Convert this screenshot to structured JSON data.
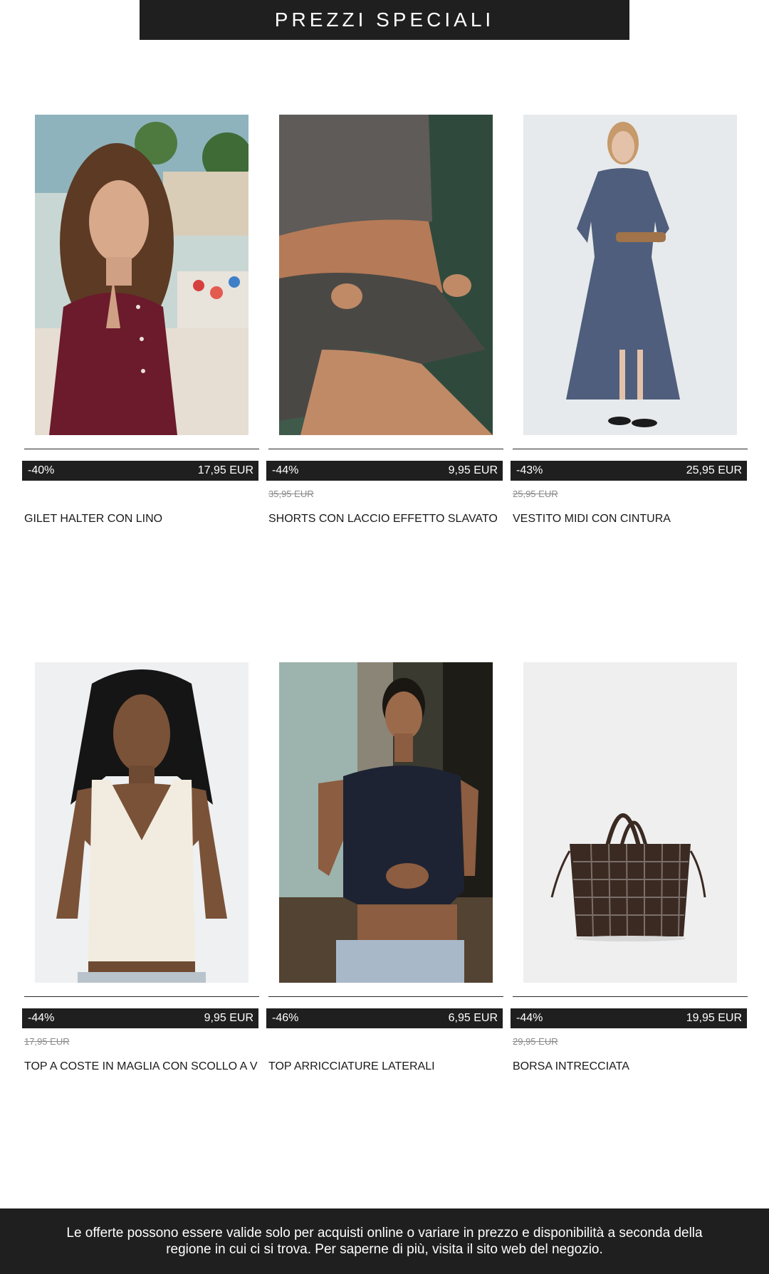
{
  "banner": {
    "title": "PREZZI SPECIALI"
  },
  "products": [
    {
      "discount": "-40%",
      "price": "17,95 EUR",
      "old_price": "",
      "name": "GILET HALTER CON LINO",
      "image": "woman-burgundy-halter-vest-by-sea"
    },
    {
      "discount": "-44%",
      "price": "9,95 EUR",
      "old_price": "35,95 EUR",
      "name": "SHORTS CON LACCIO EFFETTO SLAVATO",
      "image": "grey-washed-drawstring-shorts"
    },
    {
      "discount": "-43%",
      "price": "25,95 EUR",
      "old_price": "25,95 EUR",
      "name": "VESTITO MIDI CON CINTURA",
      "image": "blue-chambray-belted-midi-dress"
    },
    {
      "discount": "-44%",
      "price": "9,95 EUR",
      "old_price": "17,95 EUR",
      "name": "TOP A COSTE IN MAGLIA CON SCOLLO A V",
      "image": "cream-ribbed-knit-v-neck-top"
    },
    {
      "discount": "-46%",
      "price": "6,95 EUR",
      "old_price": "",
      "name": "TOP ARRICCIATURE LATERALI",
      "image": "navy-side-ruched-top"
    },
    {
      "discount": "-44%",
      "price": "19,95 EUR",
      "old_price": "29,95 EUR",
      "name": "BORSA INTRECCIATA",
      "image": "brown-woven-tote-bag"
    }
  ],
  "footer": {
    "note": "Le offerte possono essere valide solo per acquisti online o variare in prezzo e disponibilità a seconda della regione in cui ci si trova. Per saperne di più, visita il sito web del negozio."
  },
  "colors": {
    "dark": "#1f1f1f",
    "white": "#ffffff",
    "muted": "#8a8a8a"
  }
}
